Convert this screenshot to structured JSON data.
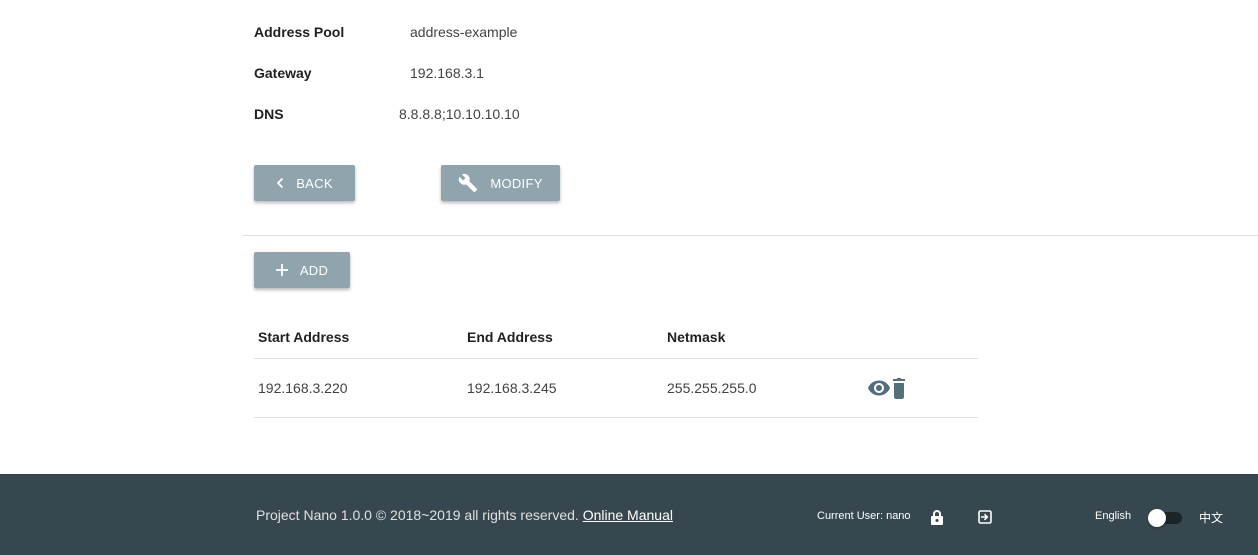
{
  "details": {
    "address_pool_label": "Address Pool",
    "address_pool_value": "address-example",
    "gateway_label": "Gateway",
    "gateway_value": "192.168.3.1",
    "dns_label": "DNS",
    "dns_value": "8.8.8.8;10.10.10.10"
  },
  "actions": {
    "back_label": "BACK",
    "modify_label": "MODIFY",
    "add_label": "ADD"
  },
  "table": {
    "headers": [
      "Start Address",
      "End Address",
      "Netmask"
    ],
    "rows": [
      {
        "start": "192.168.3.220",
        "end": "192.168.3.245",
        "netmask": "255.255.255.0"
      }
    ]
  },
  "footer": {
    "copyright": "Project Nano 1.0.0 © 2018~2019 all rights reserved. ",
    "manual_link": "Online Manual",
    "current_user": "Current User: nano",
    "lang_en": "English",
    "lang_zh": "中文"
  },
  "icons": {
    "back": "chevron-left-icon",
    "modify": "wrench-icon",
    "add": "plus-icon",
    "view": "eye-icon",
    "delete": "trash-icon",
    "lock": "lock-icon",
    "logout": "logout-icon"
  },
  "colors": {
    "button": "#90a4ae",
    "footer": "#37474f",
    "action_icon": "#546e7a"
  }
}
